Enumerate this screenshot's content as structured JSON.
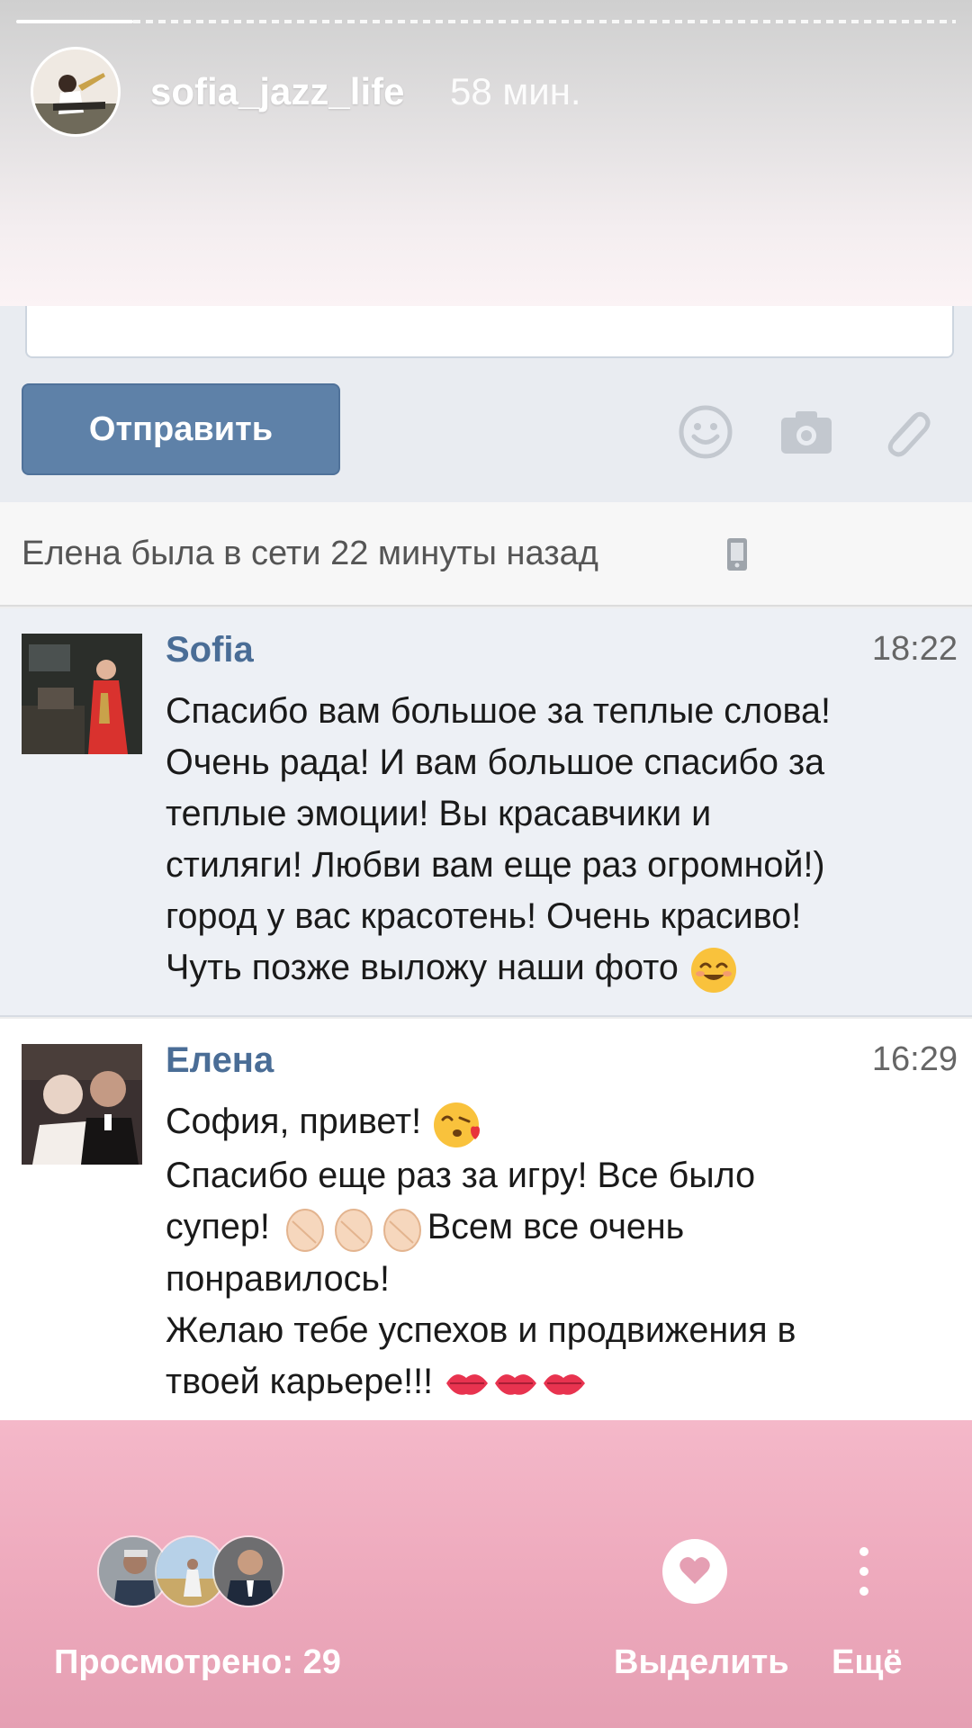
{
  "story": {
    "username": "sofia_jazz_life",
    "time_ago": "58 мин."
  },
  "composer": {
    "send_label": "Отправить",
    "icons": [
      "smile-icon",
      "camera-icon",
      "paperclip-icon"
    ]
  },
  "status": {
    "text": "Елена была в сети 22 минуты назад",
    "icon": "mobile-phone-icon"
  },
  "messages": [
    {
      "author": "Sofia",
      "time": "18:22",
      "lines": [
        "Спасибо вам большое за теплые слова!",
        "Очень рада! И вам большое спасибо за",
        "теплые эмоции! Вы красавчики и",
        "стиляги! Любви вам еще раз огромной!)",
        "город у вас красотень! Очень красиво!",
        "Чуть позже выложу наши фото"
      ]
    },
    {
      "author": "Елена",
      "time": "16:29",
      "line1": "София, привет!",
      "line2": "Спасибо еще раз за игру! Все было",
      "line3_a": "супер!",
      "line3_b": "Всем все очень",
      "line4": "понравилось!",
      "line5": "Желаю тебе успехов и продвижения в",
      "line6": "твоей карьере!!!"
    }
  ],
  "footer": {
    "views_label": "Просмотрено: 29",
    "highlight_label": "Выделить",
    "more_label": "Ещё"
  },
  "colors": {
    "vk_blue": "#5e81a8",
    "name_blue": "#4a6d96",
    "footer_pink": "#f4b8c9"
  }
}
